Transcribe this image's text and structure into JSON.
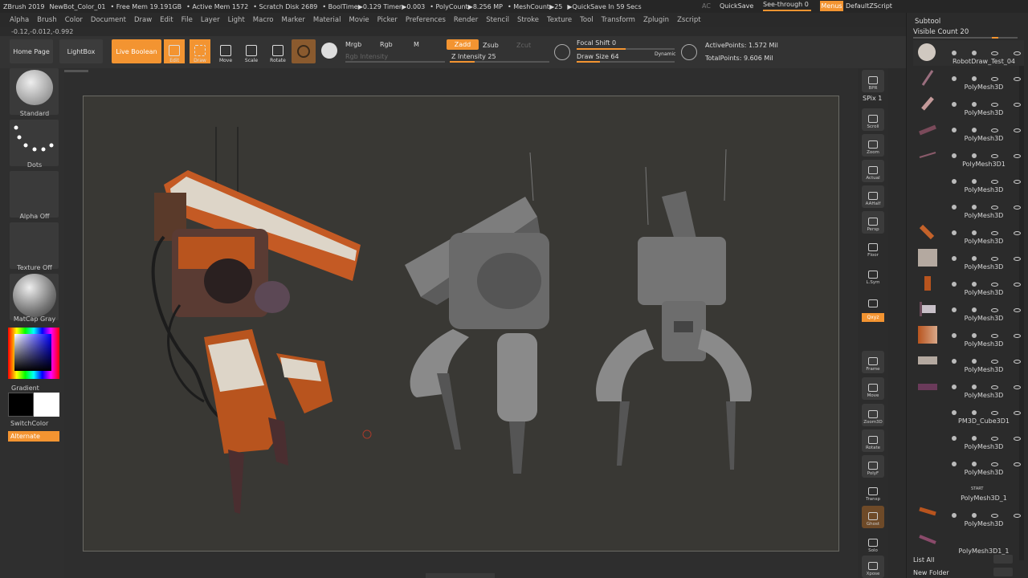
{
  "topbar": {
    "app": "ZBrush 2019",
    "doc": "NewBot_Color_01",
    "stats": [
      "• Free Mem 19.191GB",
      "• Active Mem 1572",
      "• Scratch Disk 2689",
      "• BoolTime▶0.129 Timer▶0.003",
      "• PolyCount▶8.256 MP",
      "• MeshCount▶25",
      "▶QuickSave In 59 Secs"
    ],
    "ac": "AC",
    "quicksave": "QuickSave",
    "see_through": "See-through",
    "see_through_value": "0",
    "menus": "Menus",
    "script": "DefaultZScript"
  },
  "menu": [
    "Alpha",
    "Brush",
    "Color",
    "Document",
    "Draw",
    "Edit",
    "File",
    "Layer",
    "Light",
    "Macro",
    "Marker",
    "Material",
    "Movie",
    "Picker",
    "Preferences",
    "Render",
    "Stencil",
    "Stroke",
    "Texture",
    "Tool",
    "Transform",
    "Zplugin",
    "Zscript"
  ],
  "coords": "-0.12,-0.012,-0.992",
  "toolbar": {
    "home": "Home Page",
    "lightbox": "LightBox",
    "live_boolean": "Live Boolean",
    "edit": "Edit",
    "draw": "Draw",
    "move": "Move",
    "scale": "Scale",
    "rotate": "Rotate",
    "mrgb": "Mrgb",
    "rgb": "Rgb",
    "m": "M",
    "rgb_intensity": "Rgb Intensity",
    "zadd": "Zadd",
    "zsub": "Zsub",
    "zcut": "Zcut",
    "z_intensity_label": "Z Intensity",
    "z_intensity": "25",
    "focal_label": "Focal Shift",
    "focal": "0",
    "drawsize_label": "Draw Size",
    "drawsize": "64",
    "dynamic": "Dynamic",
    "active_points": "ActivePoints: 1.572 Mil",
    "total_points": "TotalPoints: 9.606 Mil"
  },
  "leftbar": {
    "standard": "Standard",
    "dots": "Dots",
    "alpha": "Alpha Off",
    "texture": "Texture Off",
    "matcap": "MatCap Gray",
    "gradient": "Gradient",
    "switchcolor": "SwitchColor",
    "alternate": "Alternate",
    "color_primary": "#000000",
    "color_secondary": "#ffffff"
  },
  "righttools": [
    {
      "name": "bpr",
      "label": "BPR"
    },
    {
      "name": "spix",
      "label": "SPix 1"
    },
    {
      "name": "scroll",
      "label": "Scroll"
    },
    {
      "name": "zoom",
      "label": "Zoom"
    },
    {
      "name": "actual",
      "label": "Actual"
    },
    {
      "name": "aahalf",
      "label": "AAHalf"
    },
    {
      "name": "persp",
      "label": "Persp"
    },
    {
      "name": "floor",
      "label": "Floor"
    },
    {
      "name": "lsym",
      "label": "L.Sym"
    },
    {
      "name": "lock",
      "label": ""
    },
    {
      "name": "xyz",
      "label": "Qxyz"
    },
    {
      "name": "frame",
      "label": "Frame"
    },
    {
      "name": "move",
      "label": "Move"
    },
    {
      "name": "zoom3d",
      "label": "Zoom3D"
    },
    {
      "name": "rotate",
      "label": "Rotate"
    },
    {
      "name": "polyf",
      "label": "PolyF"
    },
    {
      "name": "transp",
      "label": "Transp"
    },
    {
      "name": "ghost",
      "label": "Ghost"
    },
    {
      "name": "solo",
      "label": "Solo"
    },
    {
      "name": "xpose",
      "label": "Xpose"
    }
  ],
  "subtool": {
    "title": "Subtool",
    "visible_count": "Visible Count 20",
    "items": [
      "RobotDraw_Test_04",
      "PolyMesh3D",
      "PolyMesh3D",
      "PolyMesh3D",
      "PolyMesh3D1",
      "PolyMesh3D",
      "PolyMesh3D",
      "PolyMesh3D",
      "PolyMesh3D",
      "PolyMesh3D",
      "PolyMesh3D",
      "PolyMesh3D",
      "PolyMesh3D",
      "PolyMesh3D",
      "PM3D_Cube3D1",
      "PolyMesh3D",
      "PolyMesh3D",
      "PolyMesh3D_1",
      "PolyMesh3D",
      "PolyMesh3D1_1"
    ],
    "list_all": "List All",
    "new_folder": "New Folder",
    "start": "START"
  }
}
